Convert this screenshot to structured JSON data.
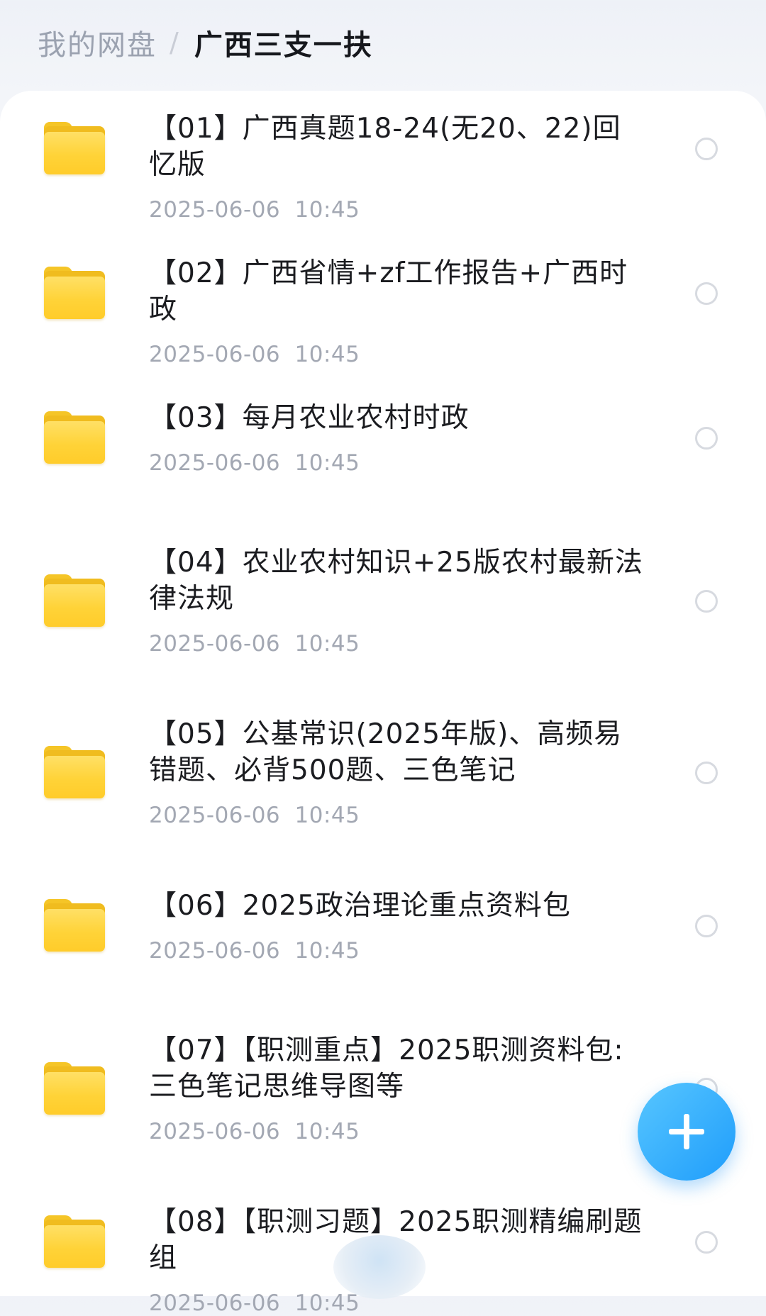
{
  "breadcrumb": {
    "root": "我的网盘",
    "separator": "/",
    "current": "广西三支一扶"
  },
  "files": [
    {
      "title": "【01】广西真题18-24(无20、22)回忆版",
      "time": "2025-06-06 10:45"
    },
    {
      "title": "【02】广西省情+zf工作报告+广西时政",
      "time": "2025-06-06 10:45"
    },
    {
      "title": "【03】每月农业农村时政",
      "time": "2025-06-06 10:45"
    },
    {
      "title": "【04】农业农村知识+25版农村最新法律法规",
      "time": "2025-06-06 10:45"
    },
    {
      "title": "【05】公基常识(2025年版)、高频易错题、必背500题、三色笔记",
      "time": "2025-06-06 10:45"
    },
    {
      "title": "【06】2025政治理论重点资料包",
      "time": "2025-06-06 10:45"
    },
    {
      "title": "【07】【职测重点】2025职测资料包:三色笔记思维导图等",
      "time": "2025-06-06 10:45"
    },
    {
      "title": "【08】【职测习题】2025职测精编刷题组",
      "time": "2025-06-06 10:45"
    }
  ],
  "icons": {
    "folder": "folder-icon",
    "select": "select-radio-icon",
    "add": "plus-icon"
  },
  "colors": {
    "folder": "#ffd338",
    "accent": "#1f9dfb",
    "title_text": "#1b1c20",
    "meta_text": "#a3a8b3"
  }
}
